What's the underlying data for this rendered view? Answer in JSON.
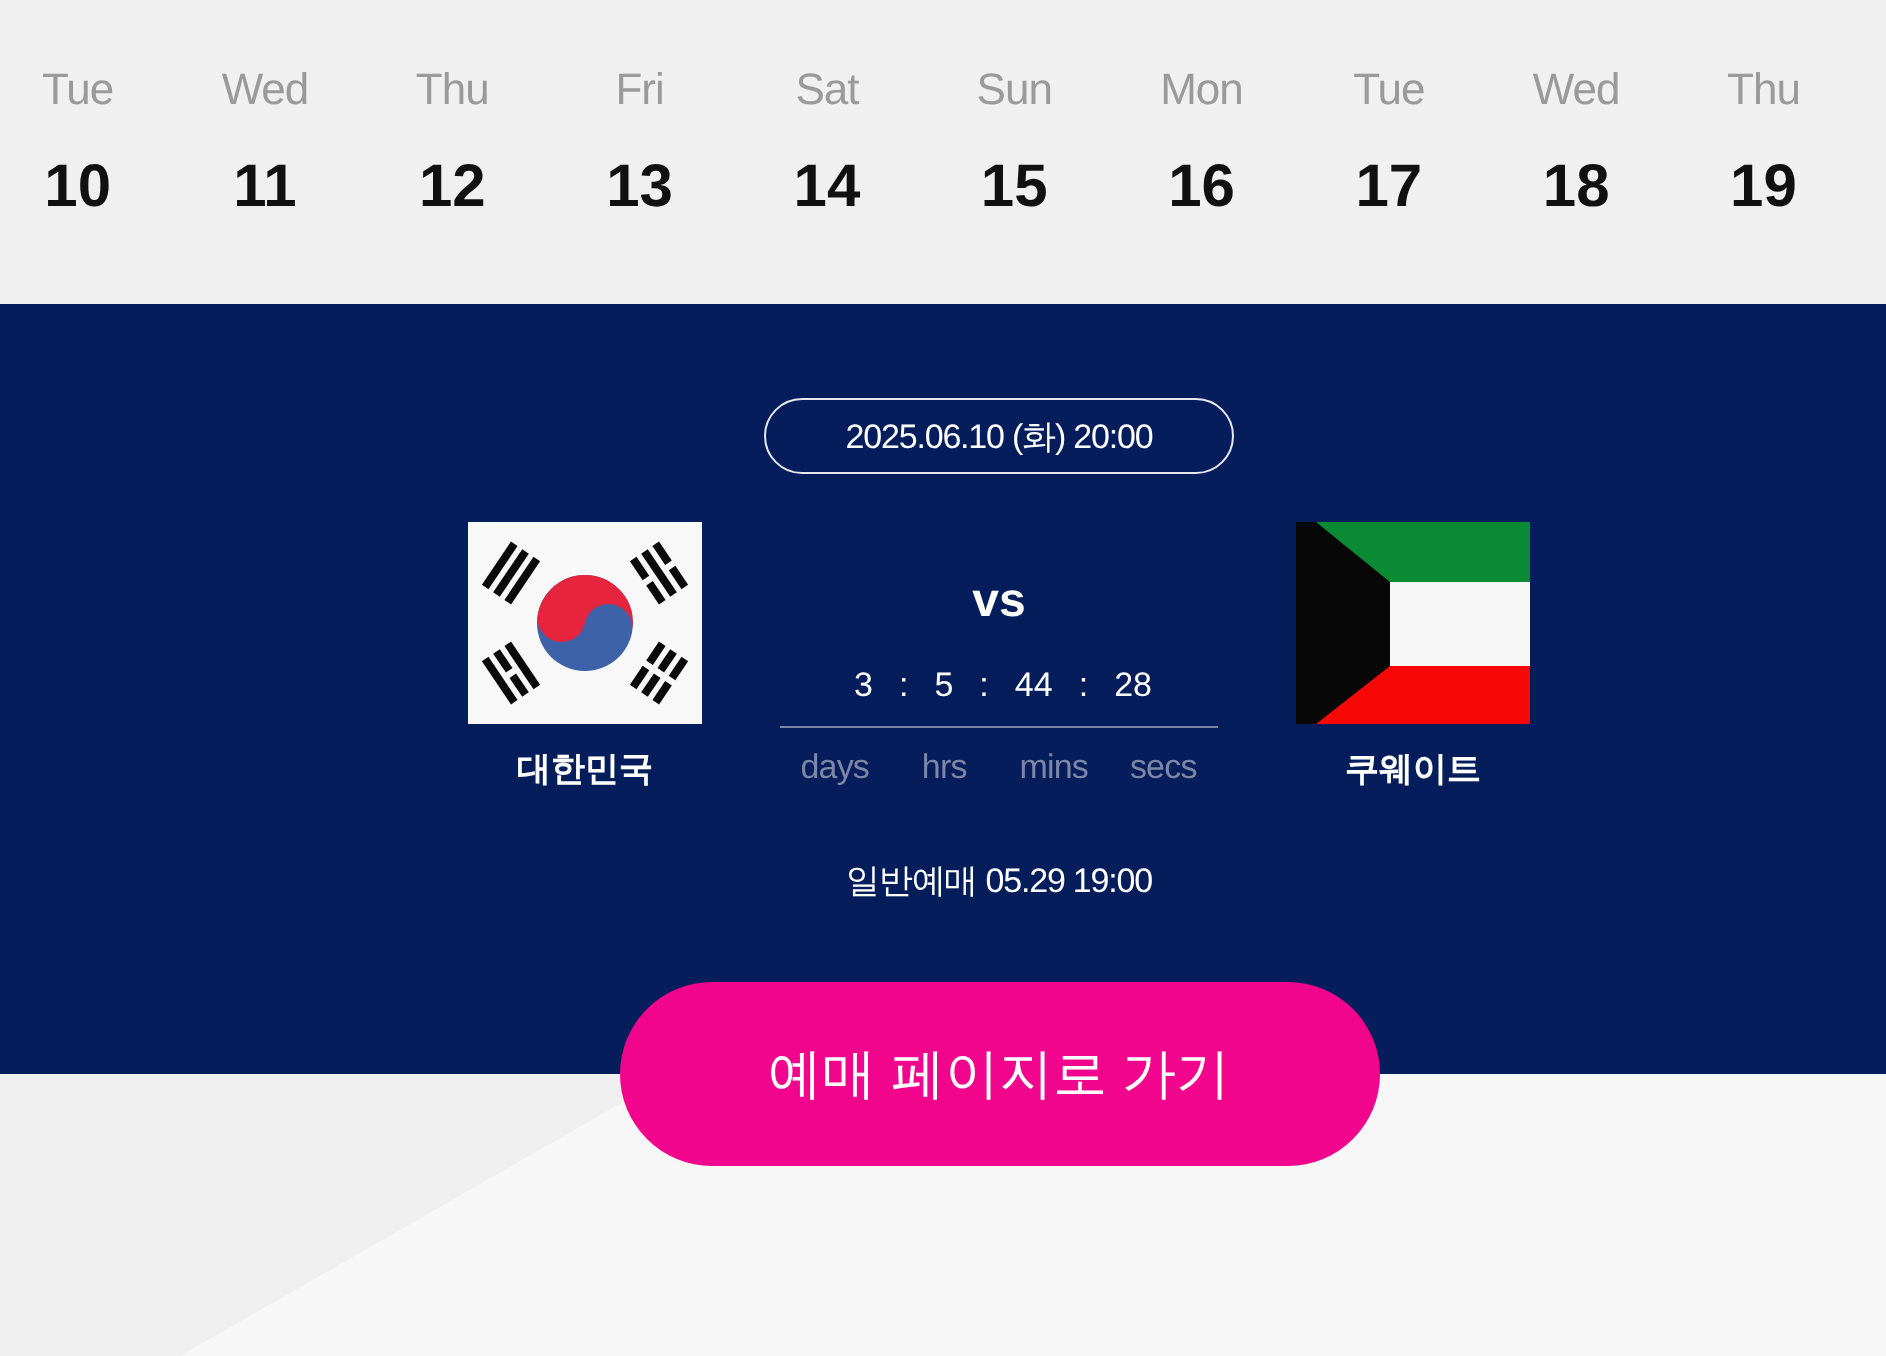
{
  "date_strip": [
    {
      "weekday": "Tue",
      "day": "10"
    },
    {
      "weekday": "Wed",
      "day": "11"
    },
    {
      "weekday": "Thu",
      "day": "12"
    },
    {
      "weekday": "Fri",
      "day": "13"
    },
    {
      "weekday": "Sat",
      "day": "14"
    },
    {
      "weekday": "Sun",
      "day": "15"
    },
    {
      "weekday": "Mon",
      "day": "16"
    },
    {
      "weekday": "Tue",
      "day": "17"
    },
    {
      "weekday": "Wed",
      "day": "18"
    },
    {
      "weekday": "Thu",
      "day": "19"
    }
  ],
  "match": {
    "datetime": "2025.06.10 (화) 20:00",
    "home_team": {
      "name": "대한민국"
    },
    "versus": "vs",
    "countdown": {
      "values": [
        "3",
        "5",
        "44",
        "28"
      ],
      "separators": [
        ":",
        ":",
        ":"
      ],
      "units": [
        "days",
        "hrs",
        "mins",
        "secs"
      ]
    },
    "away_team": {
      "name": "쿠웨이트"
    },
    "general_sale": "일반예매 05.29 19:00"
  },
  "booking_button": {
    "label": "예매 페이지로 가기"
  }
}
